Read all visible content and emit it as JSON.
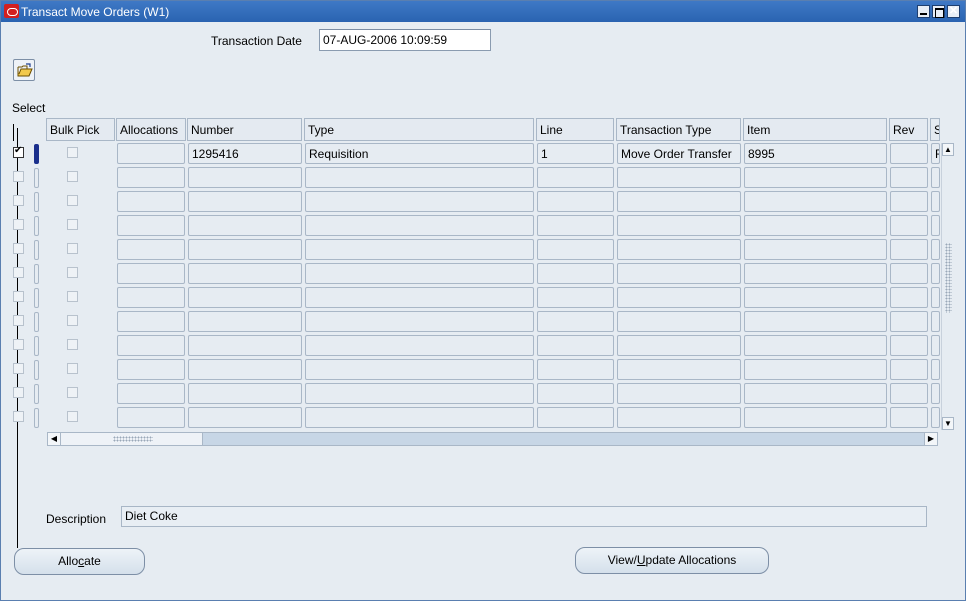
{
  "window": {
    "title": "Transact Move Orders (W1)"
  },
  "header": {
    "transaction_date_label": "Transaction Date",
    "transaction_date_value": "07-AUG-2006 10:09:59"
  },
  "toolbar": {
    "icon": "open-folder-icon"
  },
  "table": {
    "select_label": "Select",
    "columns": [
      "Bulk Pick",
      "Allocations",
      "Number",
      "Type",
      "Line",
      "Transaction Type",
      "Item",
      "Rev",
      "S"
    ],
    "rows": [
      {
        "selected": true,
        "number": "1295416",
        "type": "Requisition",
        "line": "1",
        "transaction_type": "Move Order Transfer",
        "item": "8995",
        "s": "F"
      }
    ],
    "empty_rows": 11
  },
  "description": {
    "label": "Description",
    "value": "Diet Coke"
  },
  "buttons": {
    "allocate_pre": "Allo",
    "allocate_u": "c",
    "allocate_post": "ate",
    "view_pre": "View/",
    "view_u": "U",
    "view_post": "pdate Allocations"
  }
}
